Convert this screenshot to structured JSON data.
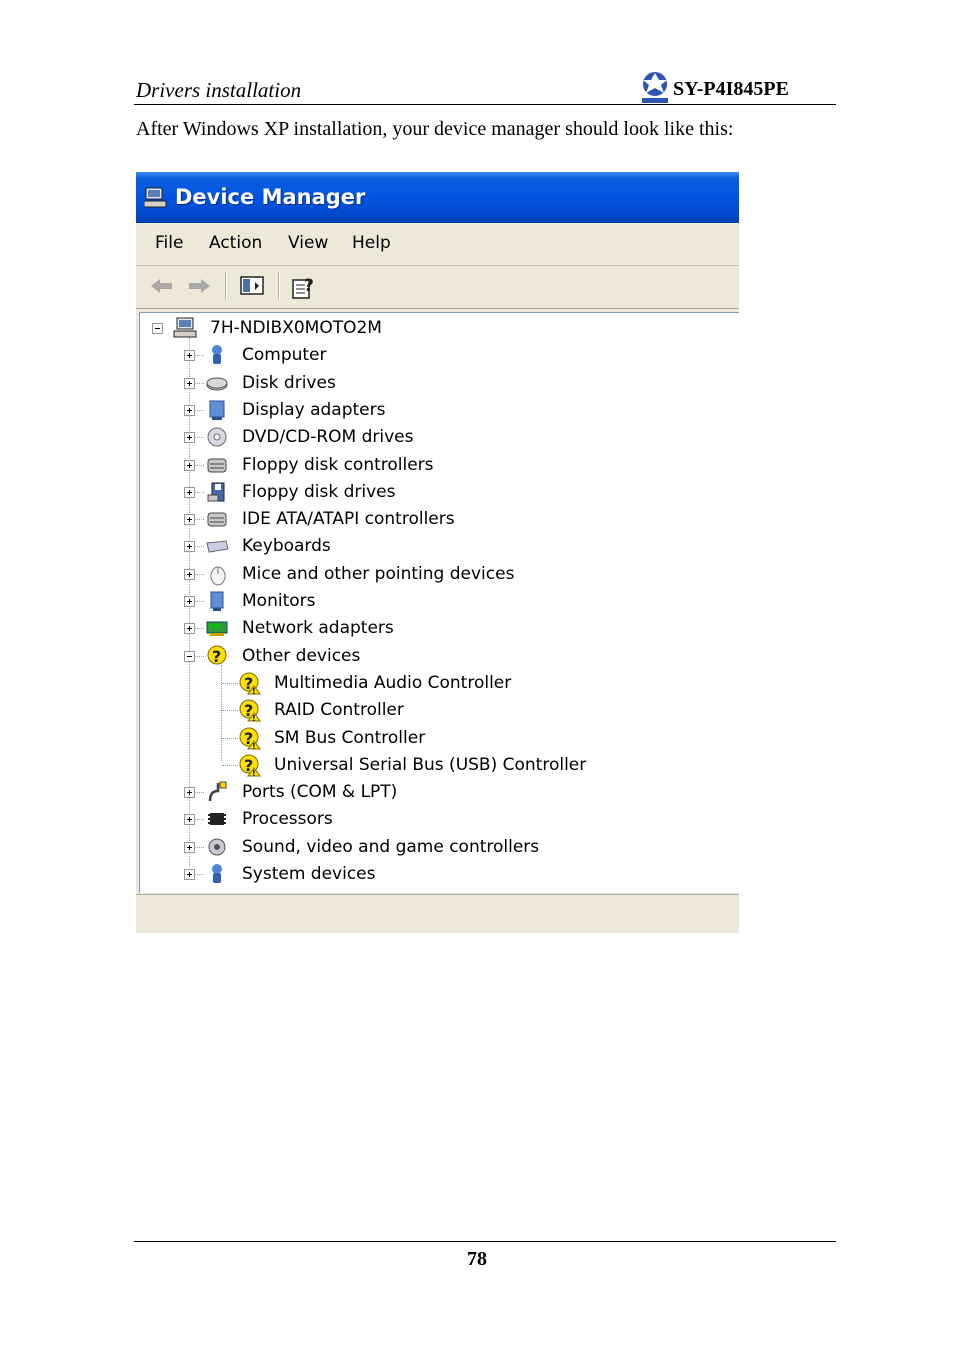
{
  "page": {
    "section_title": "Drivers installation",
    "model": "SY-P4I845PE",
    "intro": "After Windows XP installation, your device manager should look like this:",
    "page_number": "78",
    "logo": "soyo-logo"
  },
  "window": {
    "title": "Device Manager",
    "menu": [
      "File",
      "Action",
      "View",
      "Help"
    ],
    "toolbar": [
      "back-arrow-icon",
      "forward-arrow-icon",
      "show-hide-tree-icon",
      "properties-icon"
    ],
    "root": "7H-NDIBX0MOTO2M",
    "categories": [
      {
        "label": "Computer",
        "icon": "computer-icon",
        "expanded": false
      },
      {
        "label": "Disk drives",
        "icon": "disk-drive-icon",
        "expanded": false
      },
      {
        "label": "Display adapters",
        "icon": "display-adapter-icon",
        "expanded": false
      },
      {
        "label": "DVD/CD-ROM drives",
        "icon": "cdrom-icon",
        "expanded": false
      },
      {
        "label": "Floppy disk controllers",
        "icon": "controller-icon",
        "expanded": false
      },
      {
        "label": "Floppy disk drives",
        "icon": "floppy-icon",
        "expanded": false
      },
      {
        "label": "IDE ATA/ATAPI controllers",
        "icon": "controller-icon",
        "expanded": false
      },
      {
        "label": "Keyboards",
        "icon": "keyboard-icon",
        "expanded": false
      },
      {
        "label": "Mice and other pointing devices",
        "icon": "mouse-icon",
        "expanded": false
      },
      {
        "label": "Monitors",
        "icon": "monitor-icon",
        "expanded": false
      },
      {
        "label": "Network adapters",
        "icon": "network-icon",
        "expanded": false
      },
      {
        "label": "Other devices",
        "icon": "unknown-device-icon",
        "expanded": true,
        "children": [
          "Multimedia Audio Controller",
          "RAID Controller",
          "SM Bus Controller",
          "Universal Serial Bus (USB) Controller"
        ]
      },
      {
        "label": "Ports (COM & LPT)",
        "icon": "port-icon",
        "expanded": false
      },
      {
        "label": "Processors",
        "icon": "processor-icon",
        "expanded": false
      },
      {
        "label": "Sound, video and game controllers",
        "icon": "sound-icon",
        "expanded": false
      },
      {
        "label": "System devices",
        "icon": "system-icon",
        "expanded": false
      }
    ]
  },
  "colors": {
    "titlebar": "#0054e3",
    "chrome": "#ece9d8",
    "warning": "#ffe000"
  }
}
